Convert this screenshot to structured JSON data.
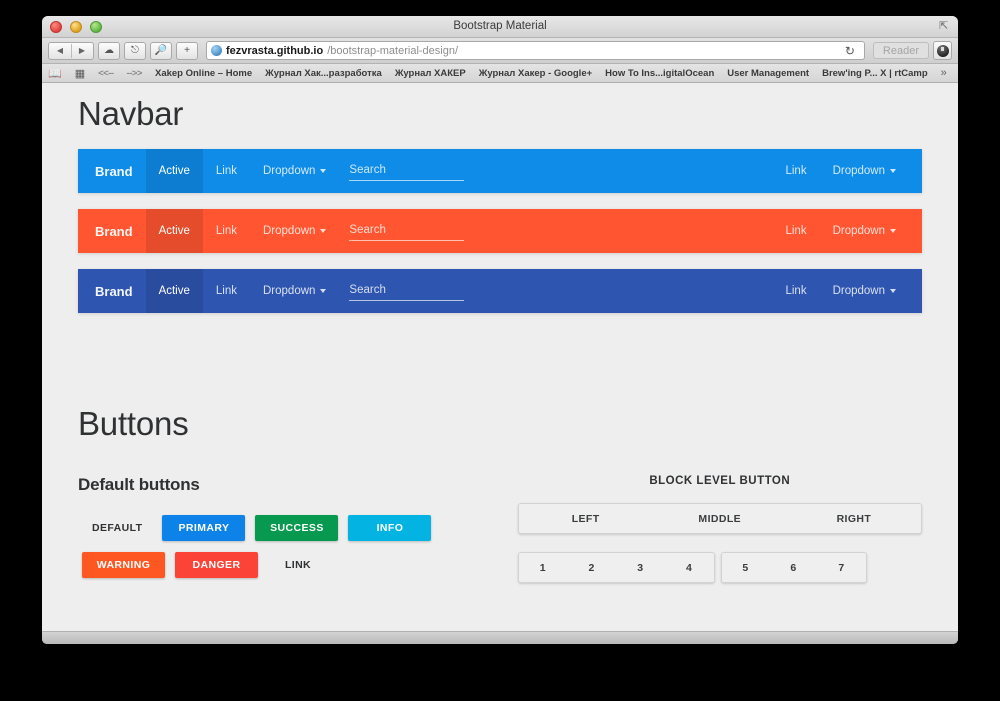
{
  "window": {
    "title": "Bootstrap Material",
    "fullscreen_icon": "fullscreen-icon"
  },
  "toolbar": {
    "back_icon": "◀",
    "forward_icon": "▶",
    "icloud_icon": "☁",
    "share_icon": "⎋",
    "reader_key_icon": "🔑",
    "add_tab_icon": "+",
    "url_host": "fezvrasta.github.io",
    "url_path": "/bootstrap-material-design/",
    "reload_icon": "↻",
    "reader_label": "Reader",
    "downloads_icon": "downloads-icon"
  },
  "bookmarks": {
    "book_icon": "📖",
    "grid_icon": "▦",
    "items": [
      {
        "label": "<<--",
        "dim": true
      },
      {
        "label": "-->>",
        "dim": true
      },
      {
        "label": "Xakep Online – Home",
        "dim": false
      },
      {
        "label": "Журнал Хак...разработка",
        "dim": false
      },
      {
        "label": "Журнал ХАКЕР",
        "dim": false
      },
      {
        "label": "Журнал Хакер - Google+",
        "dim": false
      },
      {
        "label": "How To Ins...igitalOcean",
        "dim": false
      },
      {
        "label": "User Management",
        "dim": false
      },
      {
        "label": "Brew'ing P... X | rtCamp",
        "dim": false
      }
    ],
    "overflow_icon": "»",
    "plus_icon": "+"
  },
  "page": {
    "navbar_heading": "Navbar",
    "buttons_heading": "Buttons",
    "navbars": [
      {
        "name": "navbar-primary",
        "color": "#0e8ce8",
        "active_bg": "rgba(0,0,0,0.10)",
        "brand": "Brand",
        "links": [
          "Active",
          "Link"
        ],
        "dropdown": "Dropdown",
        "search_placeholder": "Search",
        "search_value": "",
        "right_link": "Link",
        "right_dropdown": "Dropdown"
      },
      {
        "name": "navbar-warning",
        "color": "#ff5530",
        "active_bg": "rgba(0,0,0,0.10)",
        "brand": "Brand",
        "links": [
          "Active",
          "Link"
        ],
        "dropdown": "Dropdown",
        "search_placeholder": "Search",
        "search_value": "",
        "right_link": "Link",
        "right_dropdown": "Dropdown"
      },
      {
        "name": "navbar-indigo",
        "color": "#2e55b0",
        "active_bg": "rgba(0,0,0,0.10)",
        "brand": "Brand",
        "links": [
          "Active",
          "Link"
        ],
        "dropdown": "Dropdown",
        "search_placeholder": "Search",
        "search_value": "",
        "right_link": "Link",
        "right_dropdown": "Dropdown"
      }
    ],
    "default_buttons": {
      "heading": "Default buttons",
      "row1": [
        {
          "label": "DEFAULT",
          "style": "flat",
          "color": "transparent"
        },
        {
          "label": "PRIMARY",
          "style": "solid",
          "color": "#0d83e9"
        },
        {
          "label": "SUCCESS",
          "style": "solid",
          "color": "#089950"
        },
        {
          "label": "INFO",
          "style": "solid",
          "color": "#03b4e3"
        }
      ],
      "row2": [
        {
          "label": "WARNING",
          "style": "solid",
          "color": "#ff5722"
        },
        {
          "label": "DANGER",
          "style": "solid",
          "color": "#fb4437"
        },
        {
          "label": "LINK",
          "style": "flat",
          "color": "transparent"
        }
      ]
    },
    "block_level": {
      "heading": "BLOCK LEVEL BUTTON",
      "row1": [
        "LEFT",
        "MIDDLE",
        "RIGHT"
      ],
      "group_a": [
        "1",
        "2",
        "3",
        "4"
      ],
      "group_b": [
        "5",
        "6",
        "7"
      ]
    }
  }
}
